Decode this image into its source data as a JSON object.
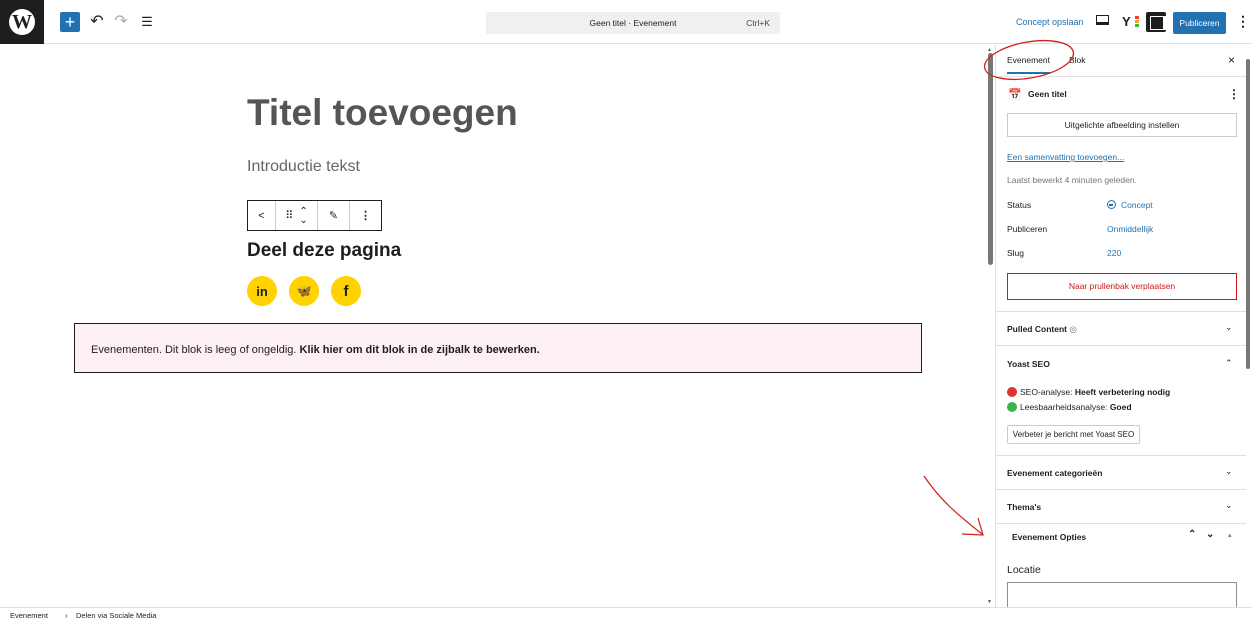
{
  "topbar": {
    "logo_glyph": "W",
    "add_glyph": "+",
    "undo_glyph": "↶",
    "redo_glyph": "↷",
    "list_view_glyph": "☰",
    "command": {
      "title": "Geen titel · Evenement",
      "shortcut": "Ctrl+K"
    },
    "save_draft_label": "Concept opslaan",
    "yoast_letter": "Y",
    "yoast_dot_colors": [
      "#e8423c",
      "#f5a623",
      "#3bb54a"
    ],
    "publish_label": "Publiceren",
    "more_glyph": "⋮",
    "accent_color": "#2271b1"
  },
  "editor": {
    "title_placeholder": "Titel toevoegen",
    "intro_text": "Introductie tekst",
    "block_toolbar": {
      "share_glyph": "<",
      "drag_glyph": "⠿",
      "up_glyph": "⌃",
      "down_glyph": "⌄",
      "edit_glyph": "✎",
      "more_glyph": "⋮"
    },
    "share_heading": "Deel deze pagina",
    "social_buttons": [
      {
        "name": "linkedin",
        "label": "in"
      },
      {
        "name": "bluesky",
        "label": "🦋"
      },
      {
        "name": "facebook",
        "label": "f"
      }
    ],
    "social_color": "#ffd200",
    "error_block": {
      "text": "Evenementen. Dit blok is leeg of ongeldig.",
      "link_text": "Klik hier om dit blok in de zijbalk te bewerken."
    }
  },
  "sidebar": {
    "tabs": [
      {
        "label": "Evenement",
        "active": true
      },
      {
        "label": "Blok",
        "active": false
      }
    ],
    "close_glyph": "×",
    "post_icon_glyph": "📅",
    "post_name": "Geen titel",
    "post_menu_glyph": "⋮",
    "featured_image_label": "Uitgelichte afbeelding instellen",
    "summary_link": "Een samenvatting toevoegen...",
    "last_edited": "Laatst bewerkt 4 minuten geleden.",
    "meta": [
      {
        "label": "Status",
        "value": "Concept"
      },
      {
        "label": "Publiceren",
        "value": "Onmiddellijk"
      },
      {
        "label": "Slug",
        "value": "220"
      }
    ],
    "trash_label": "Naar prullenbak verplaatsen",
    "panels": {
      "pulled_content": "Pulled Content",
      "pulled_content_icon": "◎",
      "yoast": "Yoast SEO",
      "categories": "Evenement categorieën",
      "themes": "Thema's",
      "options": "Evenement Opties"
    },
    "yoast_seo": {
      "seo_label": "SEO-analyse:",
      "seo_value": "Heeft verbetering nodig",
      "seo_color": "#dc3232",
      "read_label": "Leesbaarheidsanalyse:",
      "read_value": "Goed",
      "read_color": "#3bb54a",
      "button_label": "Verbeter je bericht met Yoast SEO"
    },
    "chevron_down": "⌄",
    "chevron_up": "⌃",
    "options_controls": {
      "up": "⌃",
      "down": "⌄",
      "toggle": "▴"
    },
    "location_label": "Locatie",
    "location_value": ""
  },
  "footer": {
    "breadcrumb": [
      "Evenement",
      "Delen via Sociale Media"
    ],
    "separator": "›"
  },
  "annotation_color": "#d0201a"
}
